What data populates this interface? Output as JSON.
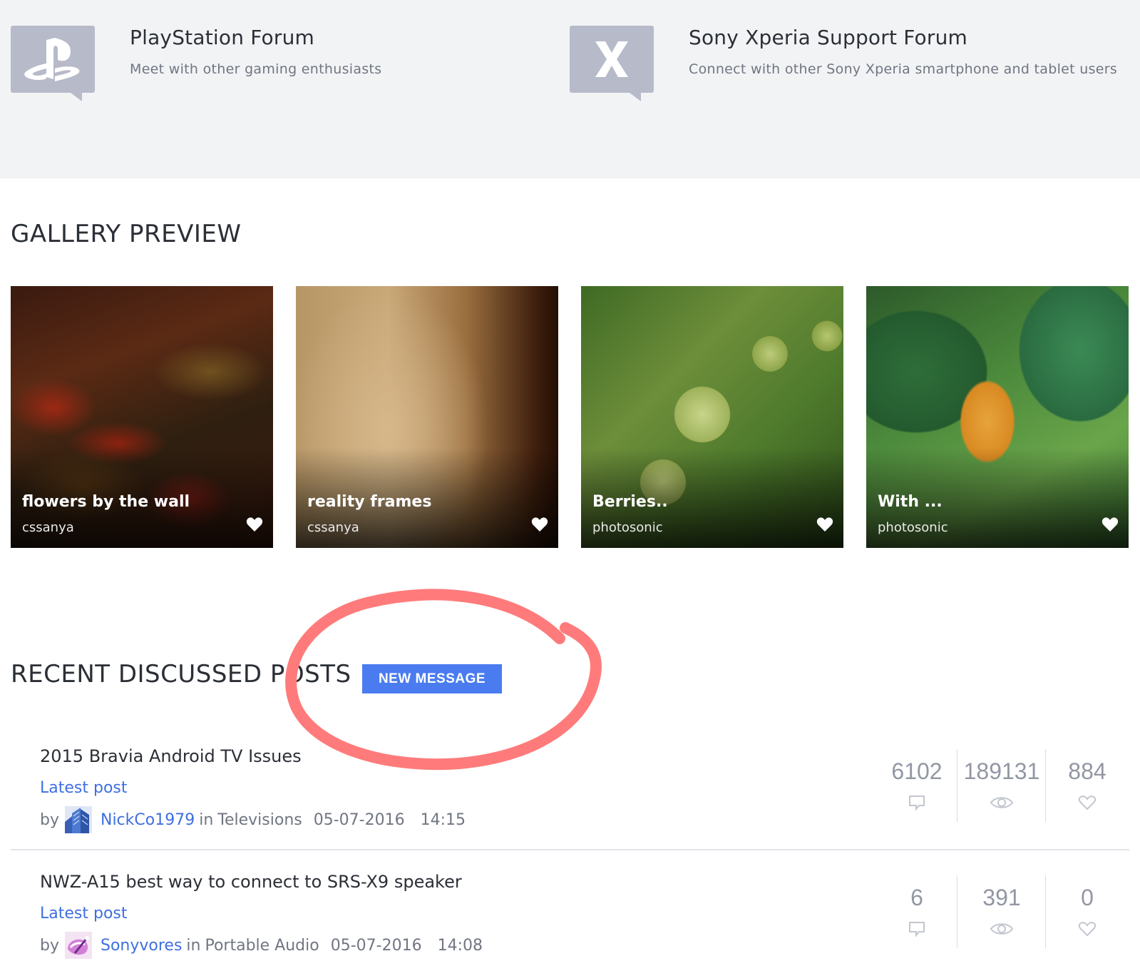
{
  "forums": [
    {
      "title": "PlayStation Forum",
      "description": "Meet with other gaming enthusiasts",
      "icon": "playstation-logo-icon"
    },
    {
      "title": "Sony Xperia Support Forum",
      "description": "Connect with other Sony Xperia smartphone and tablet users",
      "icon": "xperia-logo-icon"
    }
  ],
  "gallery": {
    "heading": "GALLERY PREVIEW",
    "tiles": [
      {
        "title": "flowers by the wall",
        "author": "cssanya"
      },
      {
        "title": "reality frames",
        "author": "cssanya"
      },
      {
        "title": "Berries..",
        "author": "photosonic"
      },
      {
        "title": "With ...",
        "author": "photosonic"
      }
    ]
  },
  "recent": {
    "heading": "RECENT DISCUSSED POSTS",
    "new_message_label": "NEW MESSAGE",
    "annotation_color": "#ff7b7b",
    "posts": [
      {
        "title": "2015 Bravia Android TV Issues",
        "latest_label": "Latest post",
        "by": "by",
        "user": "NickCo1979",
        "in_label": "in",
        "category": "Televisions",
        "date": "05-07-2016",
        "time": "14:15",
        "replies": "6102",
        "views": "189131",
        "kudos": "884"
      },
      {
        "title": "NWZ-A15 best way to connect to SRS-X9 speaker",
        "latest_label": "Latest post",
        "by": "by",
        "user": "Sonyvores",
        "in_label": "in",
        "category": "Portable Audio",
        "date": "05-07-2016",
        "time": "14:08",
        "replies": "6",
        "views": "391",
        "kudos": "0"
      }
    ]
  },
  "colors": {
    "accent": "#4a7cf0",
    "link": "#3e6fe0",
    "band": "#f2f3f5",
    "icon_tile": "#b7bac9"
  }
}
